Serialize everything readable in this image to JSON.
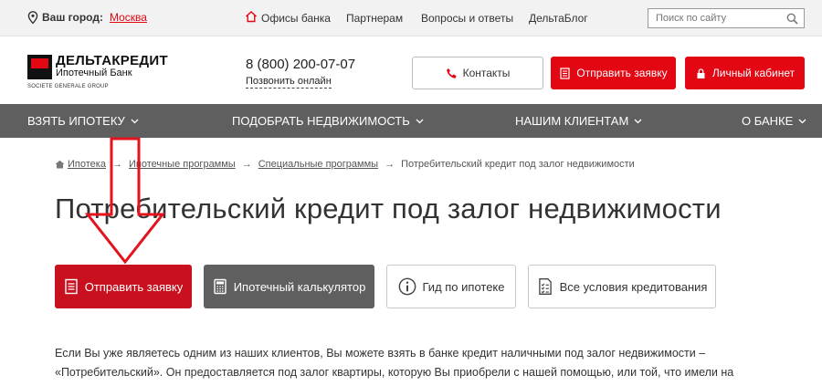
{
  "topbar": {
    "city_label": "Ваш город:",
    "city_value": "Москва",
    "links": [
      "Офисы банка",
      "Партнерам",
      "Вопросы и ответы",
      "ДельтаБлог"
    ],
    "search_placeholder": "Поиск по сайту"
  },
  "header": {
    "logo_name": "ДЕЛЬТАКРЕДИТ",
    "logo_sub": "Ипотечный Банк",
    "logo_group": "SOCIETE GENERALE GROUP",
    "phone": "8 (800) 200-07-07",
    "callback": "Позвонить онлайн",
    "contacts": "Контакты",
    "send_request": "Отправить заявку",
    "cabinet": "Личный кабинет"
  },
  "nav": {
    "items": [
      "ВЗЯТЬ ИПОТЕКУ",
      "ПОДОБРАТЬ НЕДВИЖИМОСТЬ",
      "НАШИМ КЛИЕНТАМ",
      "О БАНКЕ"
    ]
  },
  "breadcrumb": {
    "items": [
      "Ипотека",
      "Ипотечные программы",
      "Специальные программы",
      "Потребительский кредит под залог недвижимости"
    ],
    "separator": "→"
  },
  "page": {
    "title": "Потребительский кредит под залог недвижимости"
  },
  "actions": {
    "send_request": "Отправить заявку",
    "calculator": "Ипотечный калькулятор",
    "guide": "Гид по ипотеке",
    "conditions": "Все условия кредитования"
  },
  "content": {
    "line1": "Если Вы уже являетесь одним из наших клиентов, Вы можете взять в банке кредит наличными под залог недвижимости –",
    "line2": "«Потребительский». Он предоставляется под залог квартиры, которую Вы приобрели с нашей помощью, или той, что имели на"
  },
  "colors": {
    "brand_red": "#e30613",
    "button_red": "#c9101e",
    "nav_gray": "#5f5f5f",
    "annotation_arrow": "#e3121c"
  }
}
